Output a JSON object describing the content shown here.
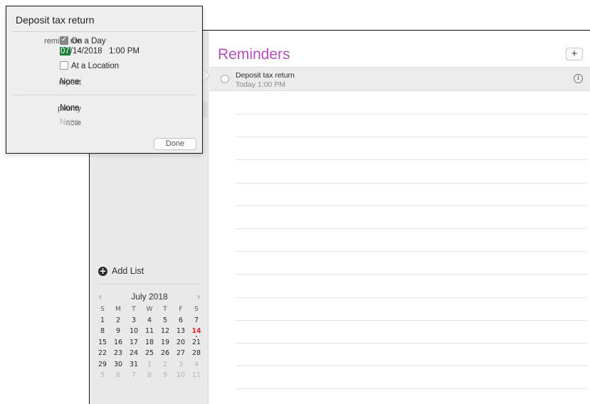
{
  "popover": {
    "title": "Deposit tax return",
    "remind_me_label": "remind me",
    "on_a_day_label": "On a Day",
    "on_a_day_checked": true,
    "date_month": "07",
    "date_rest": "/14/2018",
    "time": "1:00 PM",
    "at_location_label": "At a Location",
    "at_location_checked": false,
    "repeat_label": "repeat",
    "repeat_value": "None",
    "priority_label": "priority",
    "priority_value": "None",
    "note_label": "note",
    "note_placeholder": "None",
    "done_label": "Done"
  },
  "sidebar": {
    "add_list_label": "Add List"
  },
  "calendar": {
    "month_label": "July 2018",
    "prev_icon": "‹",
    "next_icon": "›",
    "weekdays": [
      "S",
      "M",
      "T",
      "W",
      "T",
      "F",
      "S"
    ],
    "weeks": [
      [
        "1",
        "2",
        "3",
        "4",
        "5",
        "6",
        "7"
      ],
      [
        "8",
        "9",
        "10",
        "11",
        "12",
        "13",
        "14"
      ],
      [
        "15",
        "16",
        "17",
        "18",
        "19",
        "20",
        "21"
      ],
      [
        "22",
        "23",
        "24",
        "25",
        "26",
        "27",
        "28"
      ],
      [
        "29",
        "30",
        "31",
        "1",
        "2",
        "3",
        "4"
      ],
      [
        "5",
        "6",
        "7",
        "8",
        "9",
        "10",
        "11"
      ]
    ],
    "today": "14",
    "today_color": "#e52b2b"
  },
  "main": {
    "list_title": "Reminders",
    "list_color": "#b150b8",
    "add_button_label": "+",
    "reminders": [
      {
        "title": "Deposit tax return",
        "due": "Today 1:00 PM"
      }
    ],
    "info_icon": "i"
  }
}
